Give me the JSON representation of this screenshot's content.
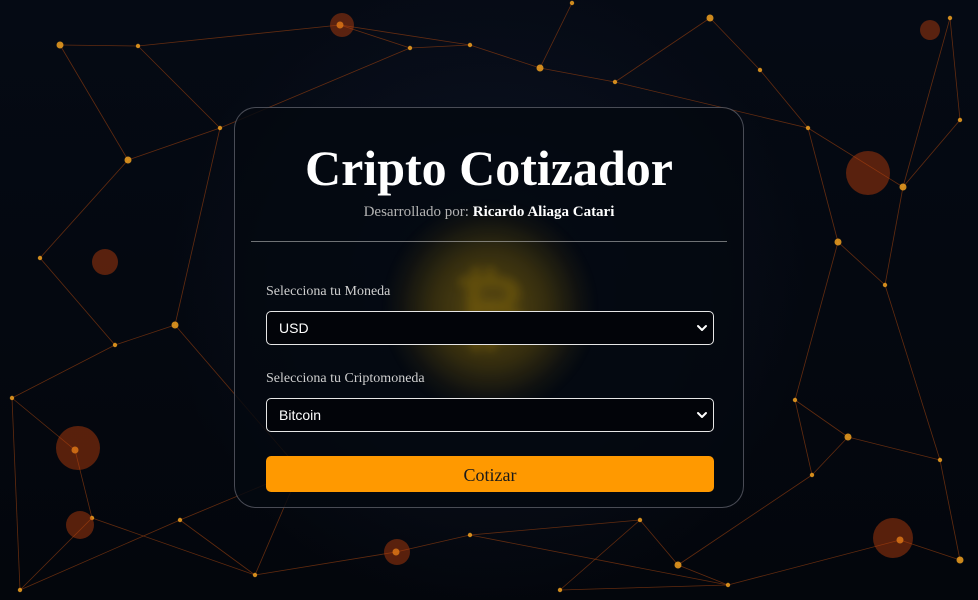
{
  "app": {
    "title": "Cripto Cotizador",
    "credit_prefix": "Desarrollado por:",
    "credit_author": "Ricardo Aliaga Catari"
  },
  "form": {
    "moneda": {
      "label": "Selecciona tu Moneda",
      "selected": "USD"
    },
    "cripto": {
      "label": "Selecciona tu Criptomoneda",
      "selected": "Bitcoin"
    },
    "submit_label": "Cotizar"
  },
  "colors": {
    "background": "#04070d",
    "accent": "#ff9900",
    "network_lines": "#8a3a10",
    "network_nodes": "#f0a020"
  },
  "icons": {
    "select_arrow": "chevron-down-icon",
    "background_coin": "bitcoin-icon"
  }
}
